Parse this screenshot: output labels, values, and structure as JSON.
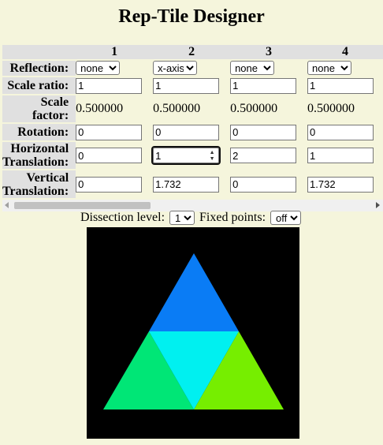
{
  "title": "Rep-Tile Designer",
  "columns": [
    "1",
    "2",
    "3",
    "4"
  ],
  "row_labels": {
    "reflection": "Reflection:",
    "scale_ratio": "Scale ratio:",
    "scale_factor_1": "Scale",
    "scale_factor_2": "factor:",
    "rotation": "Rotation:",
    "htrans_1": "Horizontal",
    "htrans_2": "Translation:",
    "vtrans_1": "Vertical",
    "vtrans_2": "Translation:"
  },
  "tiles": [
    {
      "reflection": "none",
      "scale_ratio": "1",
      "scale_factor": "0.500000",
      "rotation": "0",
      "htrans": "0",
      "vtrans": "0"
    },
    {
      "reflection": "x-axis",
      "scale_ratio": "1",
      "scale_factor": "0.500000",
      "rotation": "0",
      "htrans": "1",
      "vtrans": "1.732"
    },
    {
      "reflection": "none",
      "scale_ratio": "1",
      "scale_factor": "0.500000",
      "rotation": "0",
      "htrans": "2",
      "vtrans": "0"
    },
    {
      "reflection": "none",
      "scale_ratio": "1",
      "scale_factor": "0.500000",
      "rotation": "0",
      "htrans": "1",
      "vtrans": "1.732"
    }
  ],
  "controls": {
    "dissection_label": "Dissection level:",
    "dissection_value": "1",
    "fixed_points_label": "Fixed points:",
    "fixed_points_value": "off"
  },
  "canvas_colors": {
    "background": "#000000",
    "top": "#0a7cf5",
    "center": "#00f0f0",
    "left": "#00e676",
    "right": "#76ee00"
  }
}
